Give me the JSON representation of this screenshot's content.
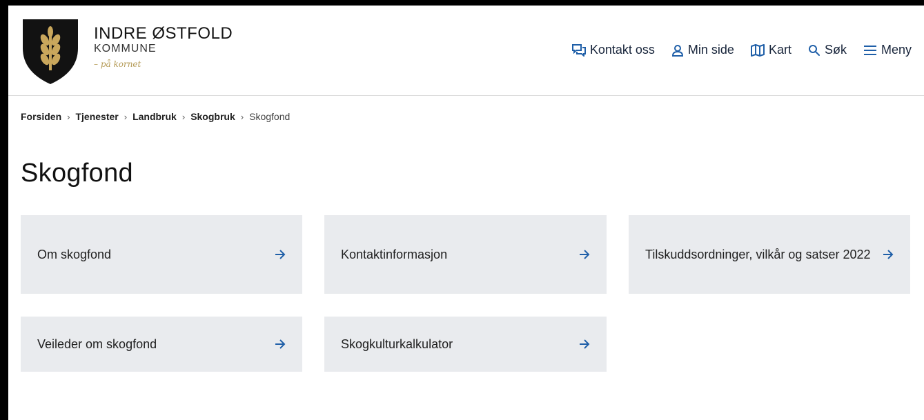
{
  "header": {
    "brand_name": "INDRE ØSTFOLD",
    "brand_sub": "KOMMUNE",
    "brand_tag": "– på kornet",
    "nav": [
      {
        "label": "Kontakt oss",
        "icon": "chat-icon"
      },
      {
        "label": "Min side",
        "icon": "user-icon"
      },
      {
        "label": "Kart",
        "icon": "map-icon"
      },
      {
        "label": "Søk",
        "icon": "search-icon"
      },
      {
        "label": "Meny",
        "icon": "menu-icon"
      }
    ]
  },
  "breadcrumb": {
    "items": [
      "Forsiden",
      "Tjenester",
      "Landbruk",
      "Skogbruk"
    ],
    "current": "Skogfond"
  },
  "page": {
    "title": "Skogfond"
  },
  "cards": [
    {
      "label": "Om skogfond"
    },
    {
      "label": "Kontaktinformasjon"
    },
    {
      "label": "Tilskuddsordninger, vilkår og satser 2022"
    },
    {
      "label": "Veileder om skogfond"
    },
    {
      "label": "Skogkulturkalkulator"
    }
  ],
  "colors": {
    "nav_icon": "#1f5fa8",
    "card_bg": "#e9ebee",
    "arrow": "#1f5fa8",
    "tagline": "#b49a55"
  }
}
